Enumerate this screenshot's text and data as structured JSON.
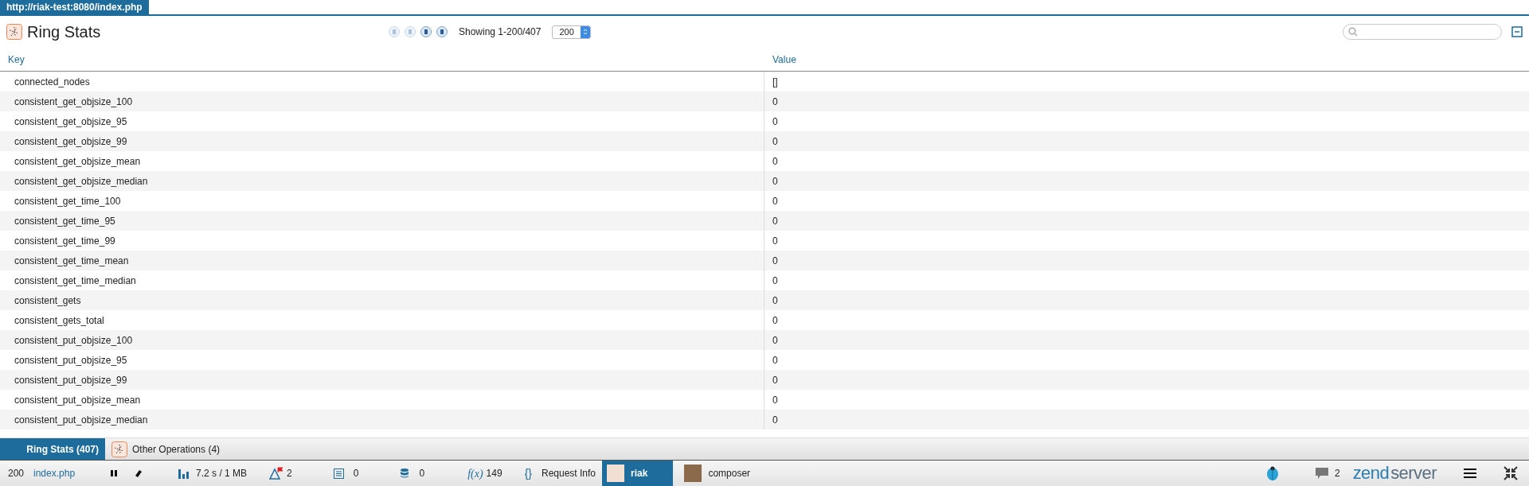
{
  "url_tab": "http://riak-test:8080/index.php",
  "header": {
    "title": "Ring Stats",
    "pager": {
      "showing": "Showing 1-200/407",
      "page_size": "200"
    }
  },
  "table": {
    "columns": [
      "Key",
      "Value"
    ],
    "rows": [
      {
        "key": "connected_nodes",
        "value": "[]"
      },
      {
        "key": "consistent_get_objsize_100",
        "value": "0"
      },
      {
        "key": "consistent_get_objsize_95",
        "value": "0"
      },
      {
        "key": "consistent_get_objsize_99",
        "value": "0"
      },
      {
        "key": "consistent_get_objsize_mean",
        "value": "0"
      },
      {
        "key": "consistent_get_objsize_median",
        "value": "0"
      },
      {
        "key": "consistent_get_time_100",
        "value": "0"
      },
      {
        "key": "consistent_get_time_95",
        "value": "0"
      },
      {
        "key": "consistent_get_time_99",
        "value": "0"
      },
      {
        "key": "consistent_get_time_mean",
        "value": "0"
      },
      {
        "key": "consistent_get_time_median",
        "value": "0"
      },
      {
        "key": "consistent_gets",
        "value": "0"
      },
      {
        "key": "consistent_gets_total",
        "value": "0"
      },
      {
        "key": "consistent_put_objsize_100",
        "value": "0"
      },
      {
        "key": "consistent_put_objsize_95",
        "value": "0"
      },
      {
        "key": "consistent_put_objsize_99",
        "value": "0"
      },
      {
        "key": "consistent_put_objsize_mean",
        "value": "0"
      },
      {
        "key": "consistent_put_objsize_median",
        "value": "0"
      }
    ]
  },
  "panel_tabs": [
    {
      "label": "Ring Stats (407)",
      "selected": true,
      "kind": "plain"
    },
    {
      "label": "Other Operations (4)",
      "selected": false,
      "kind": "iconic"
    }
  ],
  "status_bar": {
    "code": "200",
    "file": "index.php",
    "timing": "7.2 s / 1 MB",
    "events": "2",
    "logs": "0",
    "queries": "0",
    "function_label": "f(x)",
    "functions": "149",
    "request_info_glyph": "{}",
    "request_info": "Request Info",
    "plugins": [
      {
        "label": "riak",
        "selected": true
      },
      {
        "label": "composer",
        "selected": false
      }
    ],
    "messages": "2",
    "logo": {
      "part1": "zend",
      "part2": "server"
    }
  }
}
